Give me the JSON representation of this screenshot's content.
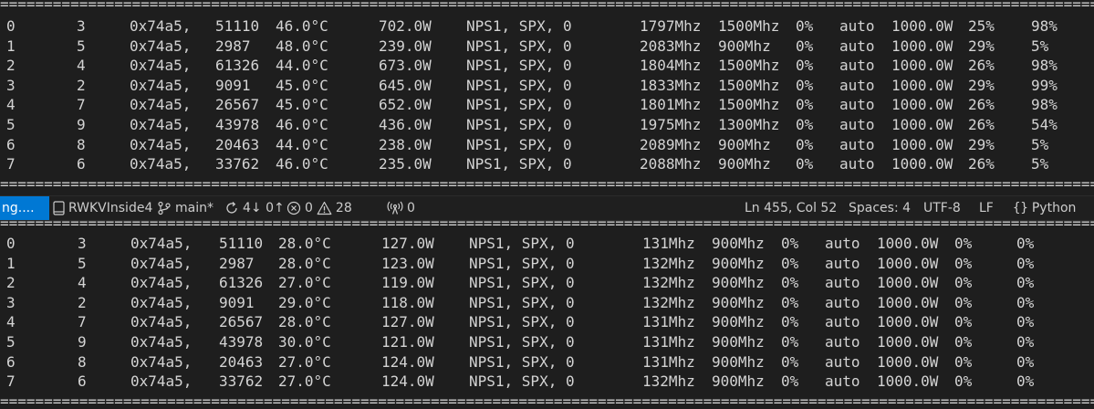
{
  "terminal_top": {
    "separator": "====================================================================================================================================================================================================================================================================================",
    "rows": [
      [
        "0",
        "3",
        "0x74a5,",
        "51110",
        "46.0°C",
        "702.0W",
        "NPS1, SPX, 0",
        "1797Mhz",
        "1500Mhz",
        "0%",
        "auto",
        "1000.0W",
        "25%",
        "98%"
      ],
      [
        "1",
        "5",
        "0x74a5,",
        "2987",
        "48.0°C",
        "239.0W",
        "NPS1, SPX, 0",
        "2083Mhz",
        "900Mhz",
        "0%",
        "auto",
        "1000.0W",
        "29%",
        "5%"
      ],
      [
        "2",
        "4",
        "0x74a5,",
        "61326",
        "44.0°C",
        "673.0W",
        "NPS1, SPX, 0",
        "1804Mhz",
        "1500Mhz",
        "0%",
        "auto",
        "1000.0W",
        "26%",
        "98%"
      ],
      [
        "3",
        "2",
        "0x74a5,",
        "9091",
        "45.0°C",
        "645.0W",
        "NPS1, SPX, 0",
        "1833Mhz",
        "1500Mhz",
        "0%",
        "auto",
        "1000.0W",
        "29%",
        "99%"
      ],
      [
        "4",
        "7",
        "0x74a5,",
        "26567",
        "45.0°C",
        "652.0W",
        "NPS1, SPX, 0",
        "1801Mhz",
        "1500Mhz",
        "0%",
        "auto",
        "1000.0W",
        "26%",
        "98%"
      ],
      [
        "5",
        "9",
        "0x74a5,",
        "43978",
        "46.0°C",
        "436.0W",
        "NPS1, SPX, 0",
        "1975Mhz",
        "1300Mhz",
        "0%",
        "auto",
        "1000.0W",
        "26%",
        "54%"
      ],
      [
        "6",
        "8",
        "0x74a5,",
        "20463",
        "44.0°C",
        "238.0W",
        "NPS1, SPX, 0",
        "2089Mhz",
        "900Mhz",
        "0%",
        "auto",
        "1000.0W",
        "29%",
        "5%"
      ],
      [
        "7",
        "6",
        "0x74a5,",
        "33762",
        "46.0°C",
        "235.0W",
        "NPS1, SPX, 0",
        "2088Mhz",
        "900Mhz",
        "0%",
        "auto",
        "1000.0W",
        "26%",
        "5%"
      ]
    ]
  },
  "status_bar": {
    "remote_label": "ng....",
    "project": "RWKVInside4",
    "branch": "main*",
    "sync": "4↓ 0↑",
    "errors": "0",
    "warnings": "28",
    "ports": "0",
    "cursor_position": "Ln 455, Col 52",
    "indentation": "Spaces: 4",
    "encoding": "UTF-8",
    "line_ending": "LF",
    "language": "Python",
    "accent_color": "#0078d4"
  },
  "terminal_bottom": {
    "separator": "====================================================================================================================================================================================================================================================================================",
    "rows": [
      [
        "0",
        "3",
        "0x74a5,",
        "51110",
        "28.0°C",
        "127.0W",
        "NPS1, SPX, 0",
        "131Mhz",
        "900Mhz",
        "0%",
        "auto",
        "1000.0W",
        "0%",
        "0%"
      ],
      [
        "1",
        "5",
        "0x74a5,",
        "2987",
        "28.0°C",
        "123.0W",
        "NPS1, SPX, 0",
        "132Mhz",
        "900Mhz",
        "0%",
        "auto",
        "1000.0W",
        "0%",
        "0%"
      ],
      [
        "2",
        "4",
        "0x74a5,",
        "61326",
        "27.0°C",
        "119.0W",
        "NPS1, SPX, 0",
        "132Mhz",
        "900Mhz",
        "0%",
        "auto",
        "1000.0W",
        "0%",
        "0%"
      ],
      [
        "3",
        "2",
        "0x74a5,",
        "9091",
        "29.0°C",
        "118.0W",
        "NPS1, SPX, 0",
        "132Mhz",
        "900Mhz",
        "0%",
        "auto",
        "1000.0W",
        "0%",
        "0%"
      ],
      [
        "4",
        "7",
        "0x74a5,",
        "26567",
        "28.0°C",
        "127.0W",
        "NPS1, SPX, 0",
        "131Mhz",
        "900Mhz",
        "0%",
        "auto",
        "1000.0W",
        "0%",
        "0%"
      ],
      [
        "5",
        "9",
        "0x74a5,",
        "43978",
        "30.0°C",
        "121.0W",
        "NPS1, SPX, 0",
        "131Mhz",
        "900Mhz",
        "0%",
        "auto",
        "1000.0W",
        "0%",
        "0%"
      ],
      [
        "6",
        "8",
        "0x74a5,",
        "20463",
        "27.0°C",
        "124.0W",
        "NPS1, SPX, 0",
        "131Mhz",
        "900Mhz",
        "0%",
        "auto",
        "1000.0W",
        "0%",
        "0%"
      ],
      [
        "7",
        "6",
        "0x74a5,",
        "33762",
        "27.0°C",
        "124.0W",
        "NPS1, SPX, 0",
        "132Mhz",
        "900Mhz",
        "0%",
        "auto",
        "1000.0W",
        "0%",
        "0%"
      ]
    ]
  }
}
